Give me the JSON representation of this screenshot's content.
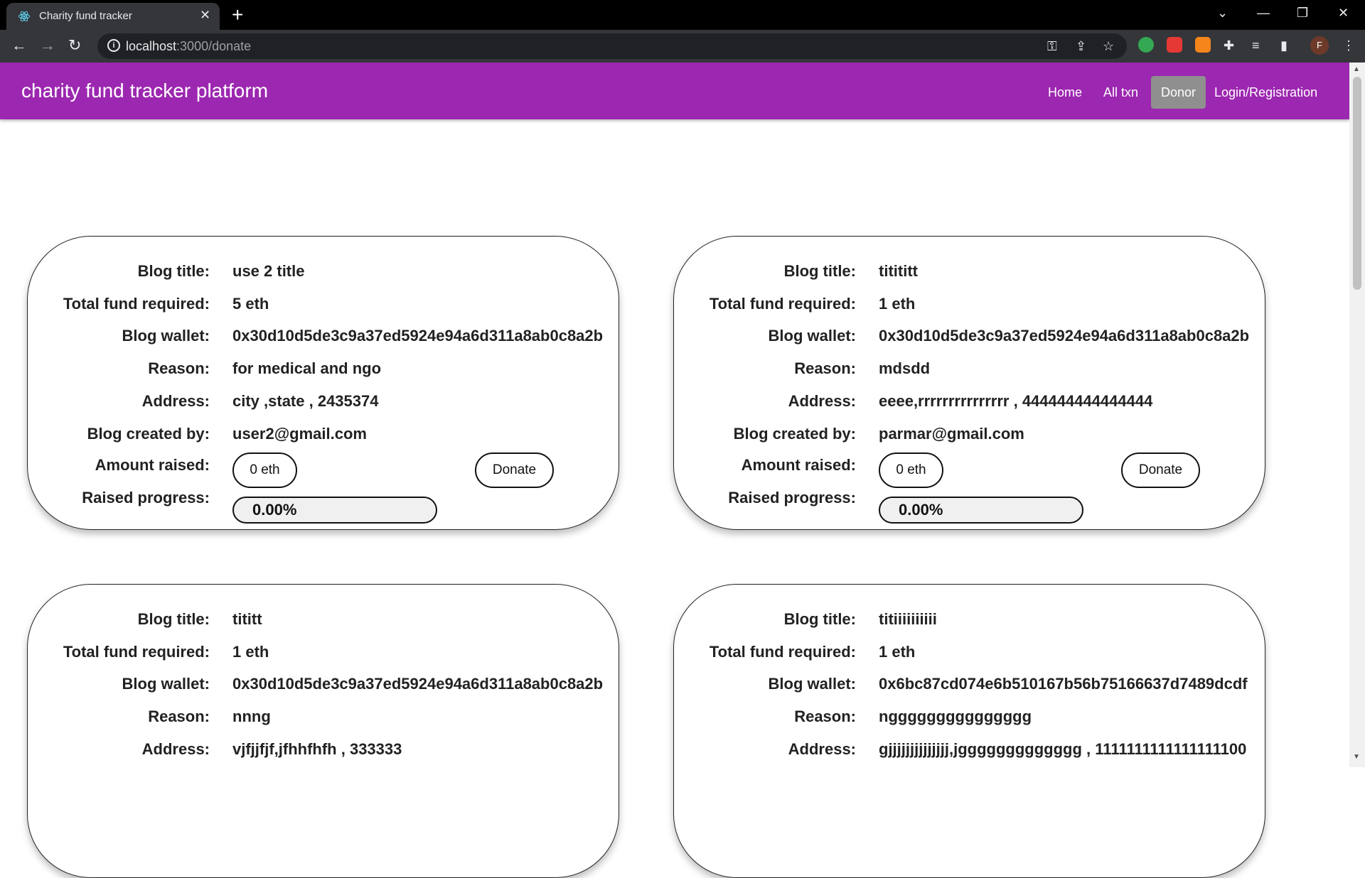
{
  "browser": {
    "tab_title": "Charity fund tracker",
    "url_host": "localhost",
    "url_path": ":3000/donate",
    "profile_initial": "F"
  },
  "navbar": {
    "brand": "charity fund tracker platform",
    "links": [
      "Home",
      "All txn",
      "Donor",
      "Login/Registration"
    ],
    "active": "Donor"
  },
  "labels": {
    "title": "Blog title:",
    "fund": "Total fund required:",
    "wallet": "Blog wallet:",
    "reason": "Reason:",
    "address": "Address:",
    "created": "Blog created by:",
    "raised": "Amount raised:",
    "progress": "Raised progress:",
    "donate": "Donate"
  },
  "cards": [
    {
      "title": "use 2 title",
      "fund": "5 eth",
      "wallet": "0x30d10d5de3c9a37ed5924e94a6d311a8ab0c8a2b",
      "reason": "for medical and ngo",
      "address": "city ,state , 2435374",
      "created": "user2@gmail.com",
      "raised": "0 eth",
      "progress": "0.00%"
    },
    {
      "title": "titititt",
      "fund": "1 eth",
      "wallet": "0x30d10d5de3c9a37ed5924e94a6d311a8ab0c8a2b",
      "reason": "mdsdd",
      "address": "eeee,rrrrrrrrrrrrrrr , 444444444444444",
      "created": "parmar@gmail.com",
      "raised": "0 eth",
      "progress": "0.00%"
    },
    {
      "title": "tititt",
      "fund": "1 eth",
      "wallet": "0x30d10d5de3c9a37ed5924e94a6d311a8ab0c8a2b",
      "reason": "nnng",
      "address": "vjfjjfjf,jfhhfhfh , 333333"
    },
    {
      "title": "titiiiiiiiiii",
      "fund": "1 eth",
      "wallet": "0x6bc87cd074e6b510167b56b75166637d7489dcdf",
      "reason": "nggggggggggggggg",
      "address": "gjjjjjjjjjjjjjj,jggggggggggggg , 1111111111111111100"
    }
  ],
  "colors": {
    "appbar": "#9c27b0",
    "active_nav": "#8f8f8f",
    "chrome_dark": "#35363a"
  }
}
